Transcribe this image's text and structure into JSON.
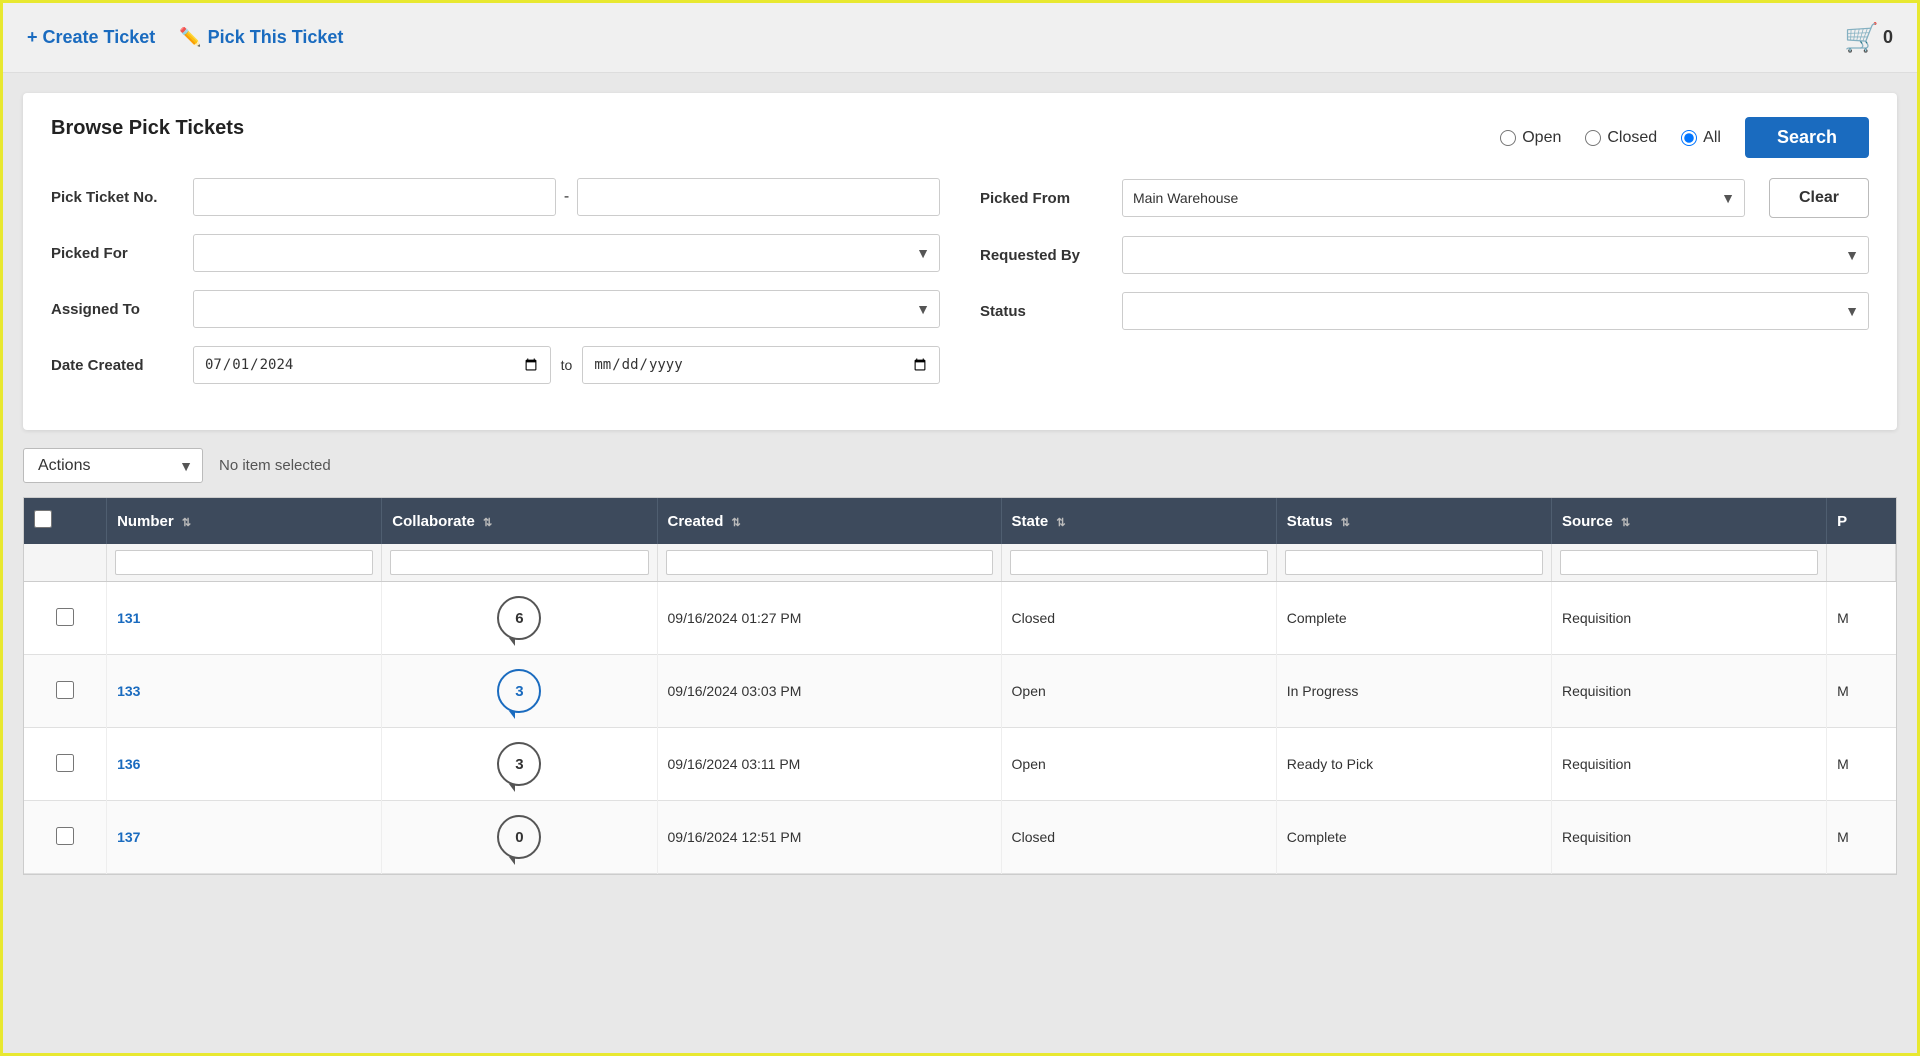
{
  "topBar": {
    "createTicket": "+ Create Ticket",
    "pickTicket": "Pick This Ticket",
    "cartCount": "0"
  },
  "browsePanel": {
    "title": "Browse Pick Tickets",
    "radioOptions": [
      {
        "label": "Open",
        "value": "open"
      },
      {
        "label": "Closed",
        "value": "closed"
      },
      {
        "label": "All",
        "value": "all",
        "checked": true
      }
    ],
    "searchBtn": "Search",
    "clearBtn": "Clear",
    "fields": {
      "pickTicketNoLabel": "Pick Ticket No.",
      "pickedFromLabel": "Picked From",
      "pickedFromValue": "Main Warehouse",
      "pickedForLabel": "Picked For",
      "requestedByLabel": "Requested By",
      "assignedToLabel": "Assigned To",
      "statusLabel": "Status",
      "dateCreatedLabel": "Date Created",
      "dateFromValue": "07/01/2024",
      "dateTo": "to",
      "dateToPlaceholder": "mm/dd/yyyy"
    }
  },
  "actionsBar": {
    "actionsLabel": "Actions",
    "noItemText": "No item selected"
  },
  "table": {
    "columns": [
      {
        "label": "Number",
        "key": "number"
      },
      {
        "label": "Collaborate",
        "key": "collaborate"
      },
      {
        "label": "Created",
        "key": "created"
      },
      {
        "label": "State",
        "key": "state"
      },
      {
        "label": "Status",
        "key": "status"
      },
      {
        "label": "Source",
        "key": "source"
      },
      {
        "label": "P",
        "key": "p"
      }
    ],
    "rows": [
      {
        "number": "131",
        "collaborateCount": "6",
        "collaborateBlue": false,
        "created": "09/16/2024 01:27 PM",
        "state": "Closed",
        "status": "Complete",
        "source": "Requisition",
        "p": "M"
      },
      {
        "number": "133",
        "collaborateCount": "3",
        "collaborateBlue": true,
        "created": "09/16/2024 03:03 PM",
        "state": "Open",
        "status": "In Progress",
        "source": "Requisition",
        "p": "M"
      },
      {
        "number": "136",
        "collaborateCount": "3",
        "collaborateBlue": false,
        "created": "09/16/2024 03:11 PM",
        "state": "Open",
        "status": "Ready to Pick",
        "source": "Requisition",
        "p": "M"
      },
      {
        "number": "137",
        "collaborateCount": "0",
        "collaborateBlue": false,
        "created": "09/16/2024 12:51 PM",
        "state": "Closed",
        "status": "Complete",
        "source": "Requisition",
        "p": "M"
      }
    ]
  }
}
